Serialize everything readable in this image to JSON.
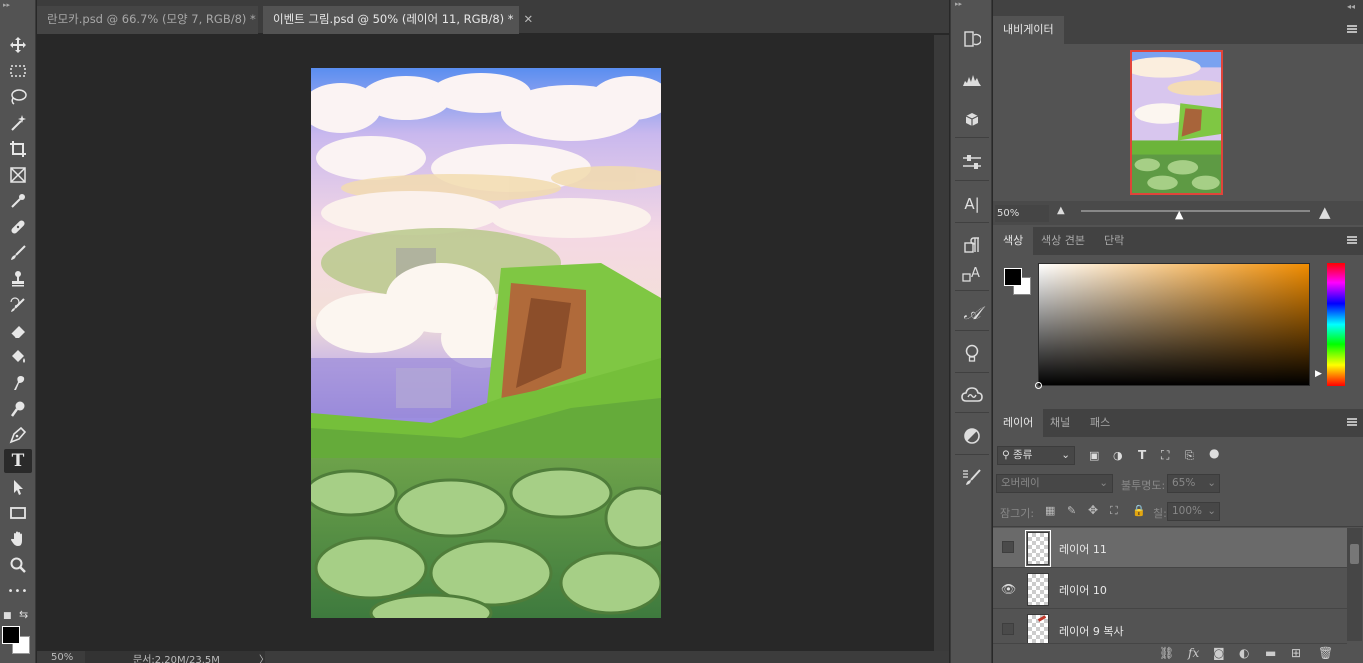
{
  "tabs": [
    {
      "label": "란모카.psd @ 66.7% (모양 7, RGB/8) *",
      "active": false
    },
    {
      "label": "이벤트 그림.psd @ 50% (레이어 11, RGB/8) *",
      "active": true
    }
  ],
  "tab_close_glyph": "✕",
  "statusbar": {
    "zoom": "50%",
    "doc_info": "문서:2.20M/23.5M",
    "arrow": "〉"
  },
  "tools": [
    "move-icon",
    "marquee-icon",
    "lasso-icon",
    "magic-wand-icon",
    "crop-icon",
    "frame-icon",
    "eyedropper-icon",
    "healing-icon",
    "brush-icon",
    "stamp-icon",
    "history-brush-icon",
    "eraser-icon",
    "paint-bucket-icon",
    "smudge-icon",
    "dodge-icon",
    "pen-icon",
    "type-icon",
    "path-select-icon",
    "rectangle-icon",
    "hand-icon",
    "zoom-icon",
    "more-icon"
  ],
  "tool_glyphs": {
    "type": "T",
    "more": "•••"
  },
  "strip_icons": [
    "history-icon",
    "histogram-icon",
    "3d-icon",
    "adjustments-icon",
    "character-icon",
    "paragraph-icon",
    "glyph-style-icon",
    "glyphs-icon",
    "learn-icon",
    "creative-cloud-icon",
    "styles-icon",
    "brush-settings-icon"
  ],
  "strip_glyphs": {
    "character": "A|",
    "glyphs": "𝒜",
    "learn": "💡"
  },
  "navigator": {
    "tab": "내비게이터",
    "zoom": "50%"
  },
  "color_panel": {
    "tabs": [
      "색상",
      "색상 견본",
      "단락"
    ],
    "active_tab": "색상",
    "accent": "#f08c00"
  },
  "layers_panel": {
    "tabs": [
      "레이어",
      "채널",
      "패스"
    ],
    "filter_label": "종류",
    "blend_mode": "오버레이",
    "opacity_label": "불투명도:",
    "opacity_value": "65%",
    "lock_label": "잠그기:",
    "fill_label": "칠:",
    "fill_value": "100%",
    "layers": [
      {
        "name": "레이어 11",
        "visible": false,
        "selected": true
      },
      {
        "name": "레이어 10",
        "visible": true,
        "selected": false
      },
      {
        "name": "레이어 9 복사",
        "visible": false,
        "selected": false
      }
    ]
  },
  "footer_icons": [
    "link-icon",
    "fx-icon",
    "mask-icon",
    "adjustment-layer-icon",
    "folder-icon",
    "new-layer-icon",
    "trash-icon"
  ],
  "footer_glyphs": {
    "fx": "fx"
  }
}
